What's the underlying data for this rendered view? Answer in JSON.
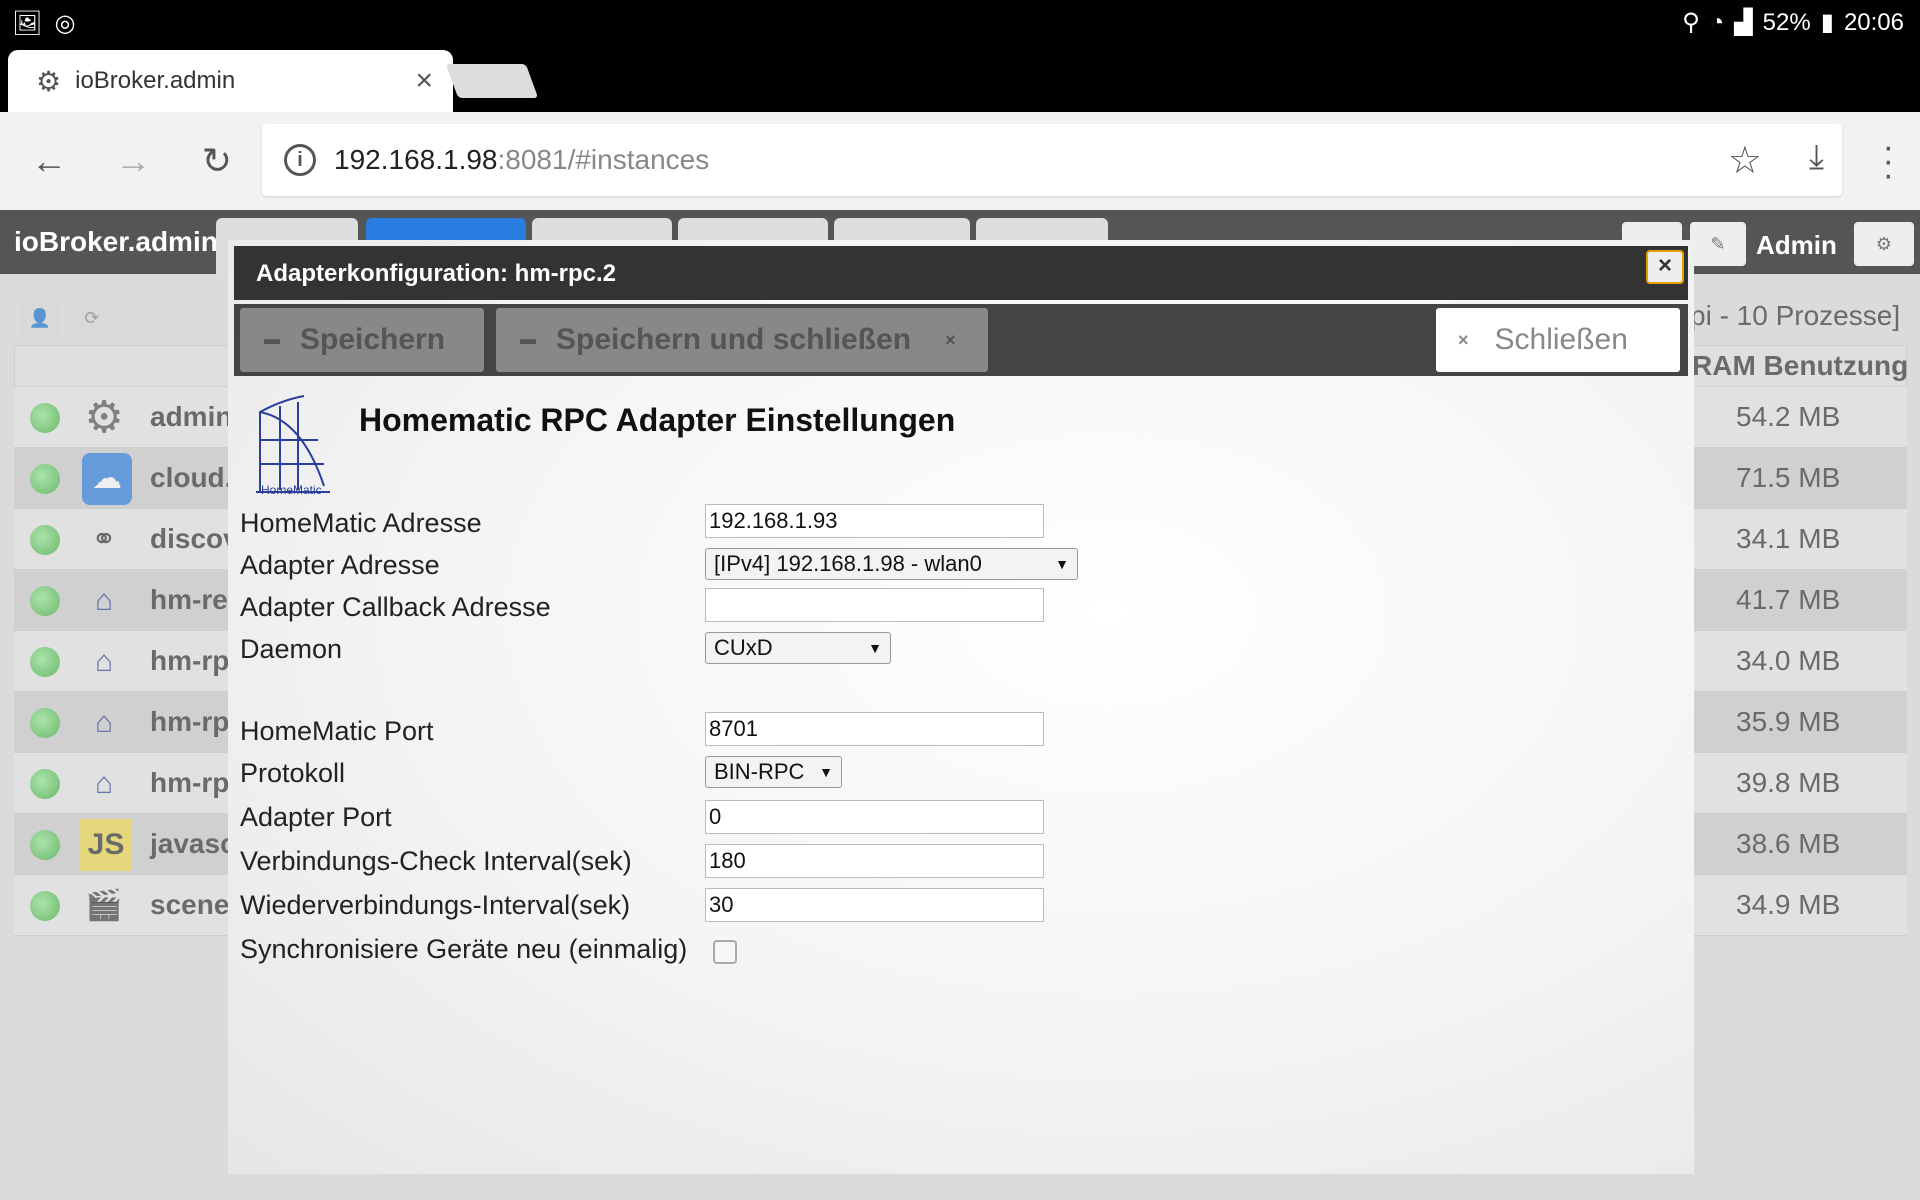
{
  "statusbar": {
    "battery": "52%",
    "time": "20:06"
  },
  "browser": {
    "tab_title": "ioBroker.admin",
    "url_host": "192.168.1.98",
    "url_rest": ":8081/#instances"
  },
  "app": {
    "brand": "ioBroker.admin",
    "user": "Admin",
    "processes": "pi - 10 Prozesse]",
    "ram_header": "RAM Benutzung",
    "instances": [
      {
        "name": "admin",
        "ram": "54.2 MB",
        "logo": "gear-icon"
      },
      {
        "name": "cloud.",
        "ram": "71.5 MB",
        "logo": "cloud-icon"
      },
      {
        "name": "discov",
        "ram": "34.1 MB",
        "logo": "binoculars-icon"
      },
      {
        "name": "hm-re",
        "ram": "41.7 MB",
        "logo": "homematic-icon"
      },
      {
        "name": "hm-rp",
        "ram": "34.0 MB",
        "logo": "homematic-icon"
      },
      {
        "name": "hm-rp",
        "ram": "35.9 MB",
        "logo": "homematic-icon"
      },
      {
        "name": "hm-rp",
        "ram": "39.8 MB",
        "logo": "homematic-icon"
      },
      {
        "name": "javasc",
        "ram": "38.6 MB",
        "logo": "js-icon"
      },
      {
        "name": "scene",
        "ram": "34.9 MB",
        "logo": "clapperboard-icon"
      }
    ]
  },
  "dialog": {
    "title": "Adapterkonfiguration: hm-rpc.2",
    "close_x": "×",
    "save": "Speichern",
    "save_close": "Speichern und schließen",
    "close": "Schließen",
    "logo_text": "HomeMatic",
    "heading": "Homematic RPC Adapter Einstellungen",
    "fields": {
      "hm_address_label": "HomeMatic Adresse",
      "hm_address_value": "192.168.1.93",
      "adapter_address_label": "Adapter Adresse",
      "adapter_address_value": "[IPv4] 192.168.1.98 - wlan0",
      "callback_label": "Adapter Callback Adresse",
      "callback_value": "",
      "daemon_label": "Daemon",
      "daemon_value": "CUxD",
      "hm_port_label": "HomeMatic Port",
      "hm_port_value": "8701",
      "protocol_label": "Protokoll",
      "protocol_value": "BIN-RPC",
      "adapter_port_label": "Adapter Port",
      "adapter_port_value": "0",
      "check_interval_label": "Verbindungs-Check Interval(sek)",
      "check_interval_value": "180",
      "reconnect_label": "Wiederverbindungs-Interval(sek)",
      "reconnect_value": "30",
      "sync_label": "Synchronisiere Geräte neu (einmalig)"
    }
  }
}
